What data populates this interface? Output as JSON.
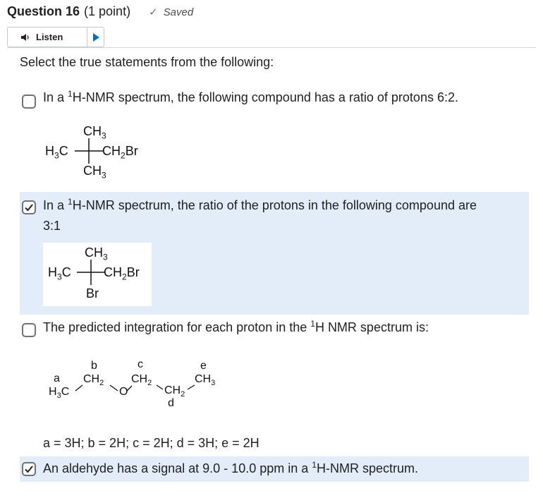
{
  "question": {
    "title": "Question 16",
    "points": "(1 point)",
    "status": "Saved"
  },
  "listen": {
    "label": "Listen",
    "speaker_icon": "speaker-icon",
    "play_icon": "play-icon"
  },
  "prompt": "Select the true statements from the following:",
  "options": [
    {
      "checked": false,
      "text_pre": "In a ",
      "sup": "1",
      "text_post": "H-NMR spectrum, the following compound has a ratio of protons 6:2.",
      "structure": {
        "top": "CH3",
        "left": "H3C",
        "right": "CH2Br",
        "bottom": "CH3"
      }
    },
    {
      "checked": true,
      "text_pre": "In a ",
      "sup": "1",
      "text_post": "H-NMR spectrum, the ratio of the protons in the following compound are",
      "text_line2": "3:1",
      "structure": {
        "top": "CH3",
        "left": "H3C",
        "right": "CH2Br",
        "bottom": "Br"
      }
    },
    {
      "checked": false,
      "text_pre": "The predicted integration for each proton in the ",
      "sup": "1",
      "text_post": "H NMR spectrum is:",
      "structure": {
        "labels": [
          "a",
          "b",
          "c",
          "d",
          "e"
        ],
        "groups": [
          "H3C",
          "CH2",
          "O",
          "CH2",
          "CH2",
          "CH3"
        ]
      },
      "answer": "a = 3H; b = 2H; c = 2H; d = 3H; e = 2H"
    },
    {
      "checked": true,
      "text_pre": "An aldehyde has a signal at 9.0 - 10.0 ppm in a ",
      "sup": "1",
      "text_post": "H-NMR spectrum."
    }
  ],
  "colors": {
    "selected_bg": "#e3edf9",
    "text": "#202122",
    "border": "#6e7376"
  }
}
